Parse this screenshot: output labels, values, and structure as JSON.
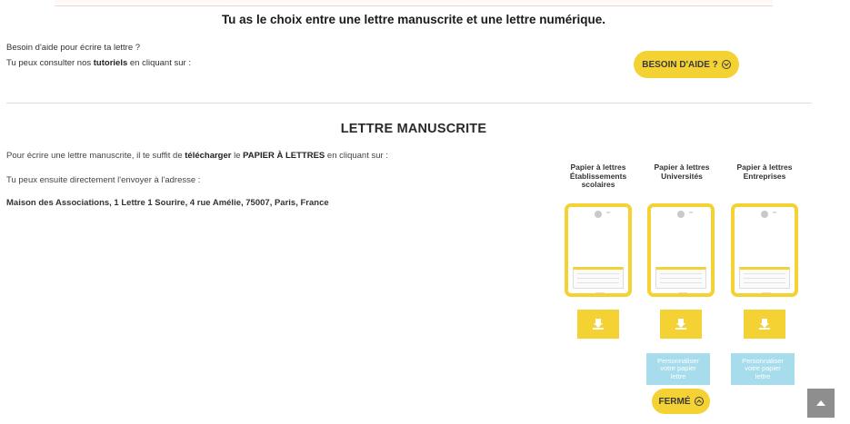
{
  "header": {
    "headline": "Tu as le choix entre une lettre manuscrite et une lettre numérique."
  },
  "help": {
    "line1": "Besoin d'aide pour écrire ta lettre ?",
    "line2_prefix": "Tu peux consulter nos ",
    "line2_bold": "tutoriels",
    "line2_suffix": " en cliquant sur :",
    "button_label": "BESOIN D'AIDE ?",
    "button_icon": "chevron-circle-down-icon"
  },
  "handwritten": {
    "title": "LETTRE MANUSCRITE",
    "instruction_prefix": "Pour écrire une lettre manuscrite, il te suffit de ",
    "instruction_bold1": "télécharger",
    "instruction_mid": " le ",
    "instruction_bold2": "PAPIER À LETTRES",
    "instruction_suffix": " en cliquant sur :",
    "send_text": "Tu peux ensuite directement l'envoyer à l'adresse :",
    "address": "Maison des Associations, 1 Lettre 1 Sourire, 4 rue Amélie, 75007, Paris, France",
    "papers": [
      {
        "title_line1": "Papier à lettres",
        "title_line2": "Établissements",
        "title_line3": "scolaires"
      },
      {
        "title_line1": "Papier à lettres",
        "title_line2": "Universités",
        "title_line3": ""
      },
      {
        "title_line1": "Papier à lettres",
        "title_line2": "Entreprises",
        "title_line3": ""
      }
    ],
    "customize_label": "Personnaliser votre papier lettre",
    "close_label": "FERMÉ",
    "close_icon": "chevron-circle-up-icon"
  },
  "colors": {
    "accent_yellow": "#f5d234",
    "accent_light_blue": "#a6dcec",
    "scroll_top_gray": "#8e8e8e"
  }
}
